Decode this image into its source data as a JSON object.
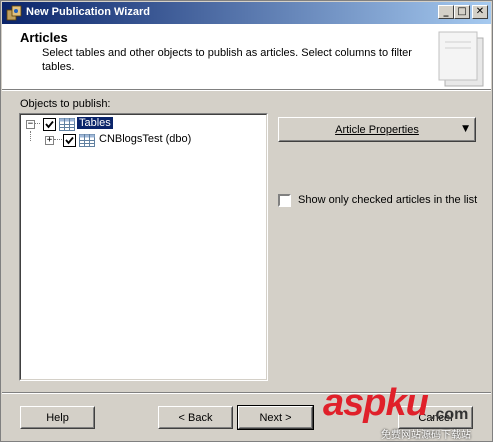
{
  "window": {
    "title": "New Publication Wizard",
    "minimize": "_",
    "maximize": "□",
    "close": "✕"
  },
  "header": {
    "title": "Articles",
    "description": "Select tables and other objects to publish as articles. Select columns to filter tables."
  },
  "objects_label": "Objects to publish:",
  "tree": {
    "root": {
      "label": "Tables",
      "checked": true,
      "expanded": true
    },
    "children": [
      {
        "label": "CNBlogsTest (dbo)",
        "checked": true,
        "expanded": false
      }
    ]
  },
  "article_properties": {
    "label": "Article Properties",
    "arrow": "▼"
  },
  "show_only_checked": {
    "label": "Show only checked articles in the list",
    "checked": false
  },
  "footer": {
    "help": "Help",
    "back": "< Back",
    "next": "Next >",
    "cancel": "Cancel"
  },
  "watermark": {
    "brand": "aspku",
    "domain": ".com",
    "tagline": "免费网站源码下载站"
  }
}
